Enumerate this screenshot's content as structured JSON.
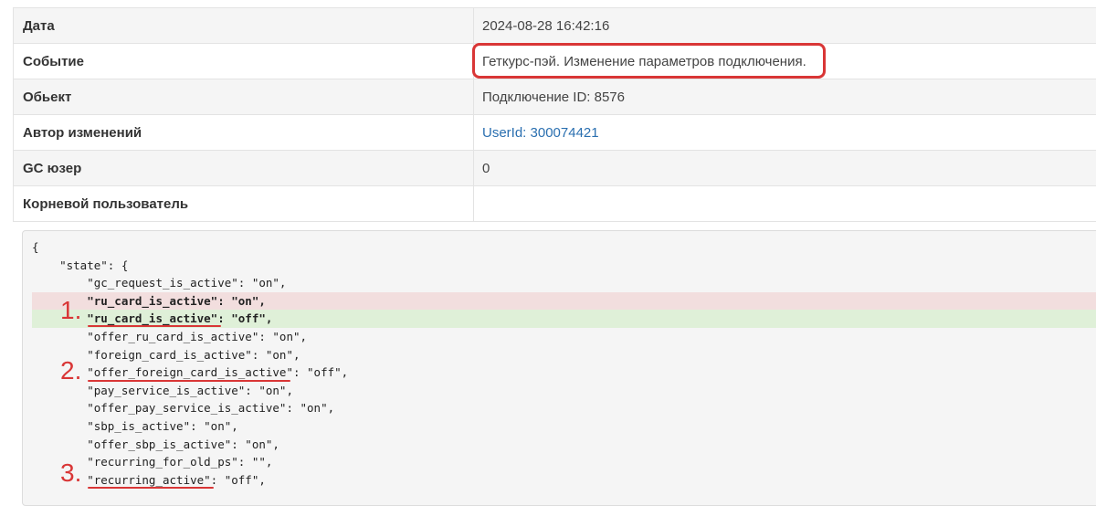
{
  "details": [
    {
      "label": "Дата",
      "value": "2024-08-28 16:42:16"
    },
    {
      "label": "Событие",
      "value": "Геткурс-пэй. Изменение параметров подключения."
    },
    {
      "label": "Обьект",
      "value": "Подключение ID: 8576"
    },
    {
      "label": "Автор изменений",
      "value": "UserId: 300074421"
    },
    {
      "label": "GC юзер",
      "value": "0"
    },
    {
      "label": "Корневой пользователь",
      "value": ""
    }
  ],
  "code_lines": [
    "{",
    "    \"state\": {",
    "        \"gc_request_is_active\": \"on\",",
    "        \"ru_card_is_active\": \"on\",",
    "        \"ru_card_is_active\": \"off\",",
    "        \"offer_ru_card_is_active\": \"on\",",
    "        \"foreign_card_is_active\": \"on\",",
    "        \"offer_foreign_card_is_active\": \"off\",",
    "        \"pay_service_is_active\": \"on\",",
    "        \"offer_pay_service_is_active\": \"on\",",
    "        \"sbp_is_active\": \"on\",",
    "        \"offer_sbp_is_active\": \"on\",",
    "        \"recurring_for_old_ps\": \"\",",
    "        \"recurring_active\": \"off\","
  ],
  "annotations": {
    "marker_1": "1.",
    "marker_2": "2.",
    "marker_3": "3."
  },
  "colors": {
    "accent_red": "#d93636",
    "diff_removed": "#f2dede",
    "diff_added": "#dff0d8",
    "link": "#2a6fb0"
  }
}
